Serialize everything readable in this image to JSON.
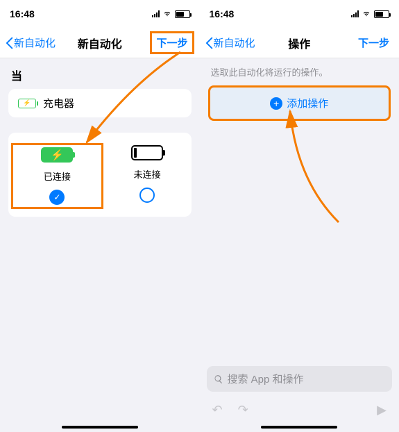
{
  "time": "16:48",
  "left": {
    "nav_back": "新自动化",
    "nav_title": "新自动化",
    "nav_next": "下一步",
    "section_label": "当",
    "charger_label": "充电器",
    "option_connected": "已连接",
    "option_disconnected": "未连接"
  },
  "right": {
    "nav_back": "新自动化",
    "nav_title": "操作",
    "nav_next": "下一步",
    "description": "选取此自动化将运行的操作。",
    "add_action": "添加操作",
    "search_placeholder": "搜索 App 和操作"
  }
}
